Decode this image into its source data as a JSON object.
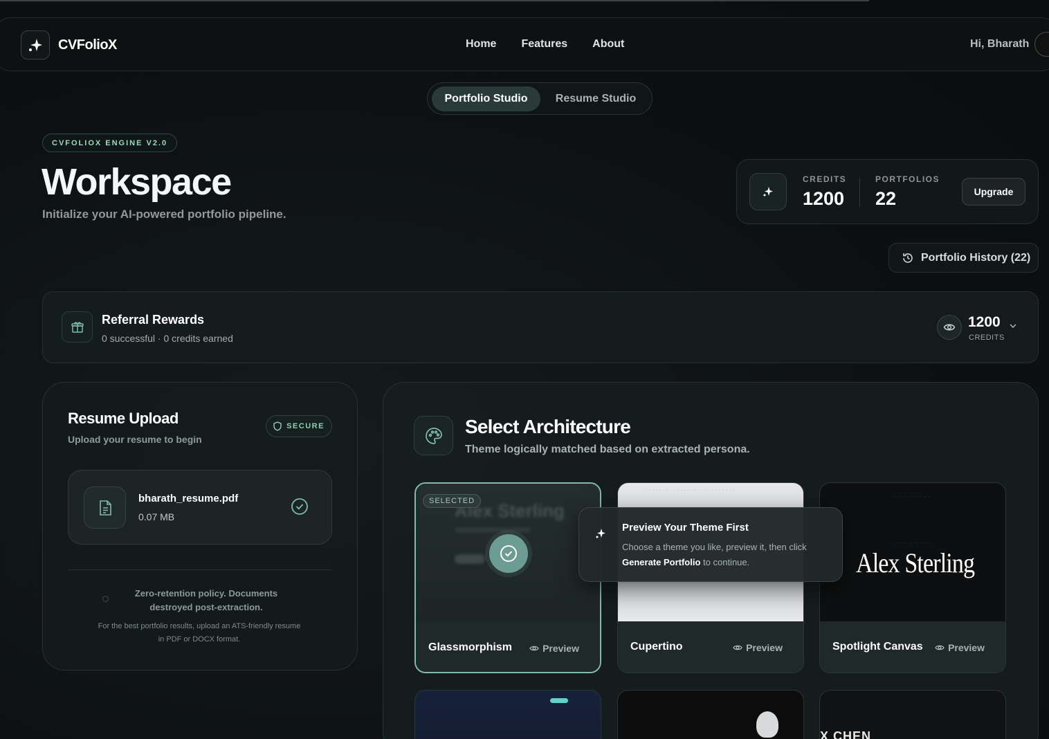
{
  "brand": {
    "name": "CVFolioX"
  },
  "nav": {
    "links": [
      "Home",
      "Features",
      "About"
    ],
    "greeting": "Hi, Bharath"
  },
  "studio_toggle": {
    "active": "Portfolio Studio",
    "inactive": "Resume Studio"
  },
  "header": {
    "badge": "CVFOLIOX ENGINE V2.0",
    "title": "Workspace",
    "subtitle": "Initialize your AI-powered portfolio pipeline."
  },
  "stats": {
    "credits_label": "CREDITS",
    "credits_value": "1200",
    "portfolios_label": "PORTFOLIOS",
    "portfolios_value": "22",
    "upgrade_label": "Upgrade"
  },
  "history_button": "Portfolio History (22)",
  "referral": {
    "title": "Referral Rewards",
    "subtitle": "0 successful · 0 credits earned",
    "credits": "1200",
    "credits_label": "CREDITS"
  },
  "upload": {
    "title": "Resume Upload",
    "subtitle": "Upload your resume to begin",
    "secure_label": "SECURE",
    "file_name": "bharath_resume.pdf",
    "file_size": "0.07 MB",
    "policy": "Zero-retention policy. Documents destroyed post-extraction.",
    "note": "For the best portfolio results, upload an ATS-friendly resume in PDF or DOCX format."
  },
  "architecture": {
    "title": "Select Architecture",
    "subtitle": "Theme logically matched based on extracted persona.",
    "selected_badge": "SELECTED",
    "preview_label": "Preview",
    "themes": [
      {
        "name": "Glassmorphism",
        "thumb_text": "Alex Sterling"
      },
      {
        "name": "Cupertino"
      },
      {
        "name": "Spotlight Canvas",
        "thumb_text": "Alex Sterling"
      }
    ],
    "bottom_thumb_text": "X CHEN"
  },
  "tooltip": {
    "title": "Preview Your Theme First",
    "body_part1": "Choose a theme you like, preview it, then click ",
    "body_bold": "Generate Portfolio",
    "body_part2": " to continue."
  },
  "colors": {
    "accent": "#7fbcae",
    "background": "#0d1112"
  }
}
